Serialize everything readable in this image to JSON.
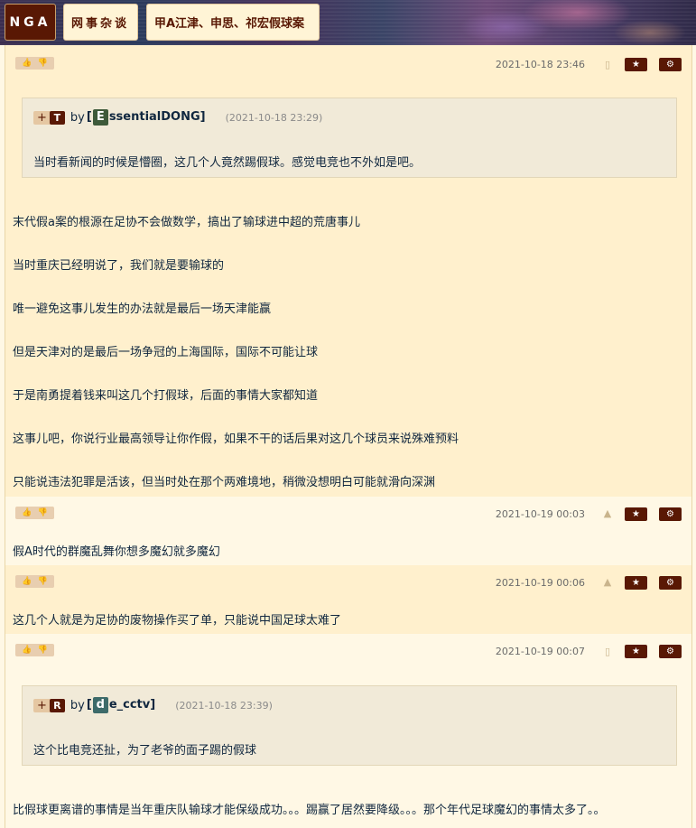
{
  "header": {
    "logo": "NGA",
    "breadcrumbs": [
      "网事杂谈",
      "甲A江津、申思、祁宏假球案"
    ]
  },
  "posts": [
    {
      "timestamp": "2021-10-18 23:46",
      "device": "phone",
      "quote": {
        "tag": "T",
        "by": "by",
        "bracket_open": "[",
        "initial": "E",
        "initial_color": "#3e5a3a",
        "username_rest": "ssentialDONG",
        "bracket_close": "]",
        "time": "(2021-10-18 23:29)",
        "text": "当时看新闻的时候是懵圈，这几个人竟然踢假球。感觉电竞也不外如是吧。"
      },
      "paragraphs": [
        "末代假a案的根源在足协不会做数学，搞出了输球进中超的荒唐事儿",
        "当时重庆已经明说了，我们就是要输球的",
        "唯一避免这事儿发生的办法就是最后一场天津能赢",
        "但是天津对的是最后一场争冠的上海国际，国际不可能让球",
        "于是南勇提着钱来叫这几个打假球，后面的事情大家都知道",
        "这事儿吧，你说行业最高领导让你作假，如果不干的话后果对这几个球员来说殊难预料",
        "只能说违法犯罪是活该，但当时处在那个两难境地，稍微没想明白可能就滑向深渊"
      ]
    },
    {
      "timestamp": "2021-10-19 00:03",
      "device": "android",
      "paragraphs": [
        "假A时代的群魔乱舞你想多魔幻就多魔幻"
      ]
    },
    {
      "timestamp": "2021-10-19 00:06",
      "device": "android",
      "paragraphs": [
        "这几个人就是为足协的废物操作买了单，只能说中国足球太难了"
      ]
    },
    {
      "timestamp": "2021-10-19 00:07",
      "device": "phone",
      "quote": {
        "tag": "R",
        "by": "by",
        "bracket_open": "[",
        "initial": "d",
        "initial_color": "#3d6b6a",
        "username_rest": "e_cctv",
        "bracket_close": "]",
        "time": "(2021-10-18 23:39)",
        "text": "这个比电竞还扯，为了老爷的面子踢的假球"
      },
      "paragraphs": [
        "比假球更离谱的事情是当年重庆队输球才能保级成功。。。踢赢了居然要降级。。。那个年代足球魔幻的事情太多了。。"
      ]
    }
  ],
  "icons": {
    "thumb_up": "thumbs-up-icon",
    "thumb_down": "thumbs-down-icon",
    "star": "star-icon",
    "gear": "gear-icon",
    "quote_plus": "+"
  },
  "colors": {
    "accent": "#591804",
    "row_alt": "#fff0cd",
    "row_base": "#fff8e5",
    "quote_bg": "#f1ead8",
    "text": "#10273f"
  }
}
